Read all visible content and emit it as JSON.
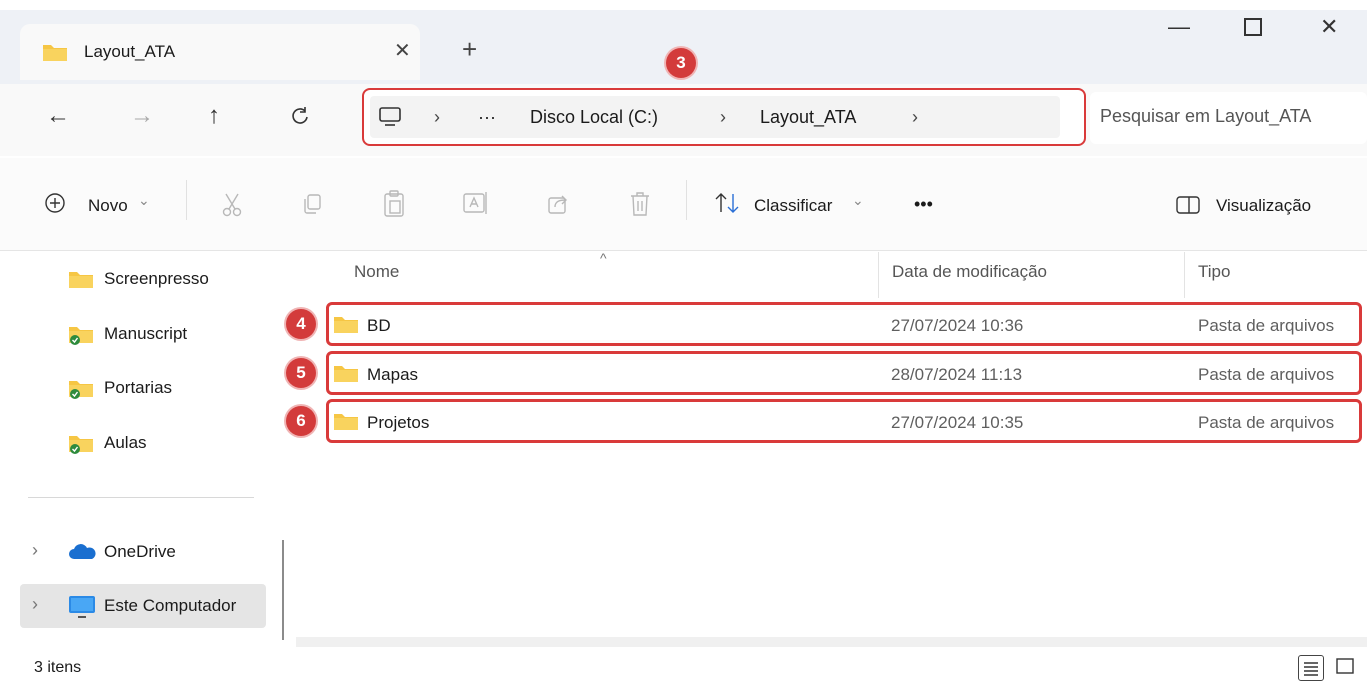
{
  "tab": {
    "title": "Layout_ATA",
    "close_glyph": "✕",
    "new_glyph": "+"
  },
  "window_controls": {
    "minimize": "—",
    "close": "✕"
  },
  "nav": {
    "back": "←",
    "forward": "→",
    "up": "↑",
    "refresh": "C"
  },
  "breadcrumb": {
    "overflow": "···",
    "sep": "›",
    "items": [
      "Disco Local (C:)",
      "Layout_ATA"
    ]
  },
  "search": {
    "placeholder": "Pesquisar em Layout_ATA"
  },
  "callouts": [
    "3",
    "4",
    "5",
    "6"
  ],
  "commandbar": {
    "new_label": "Novo",
    "sort_label": "Classificar",
    "more": "•••",
    "view_label": "Visualização",
    "dropdown": "⌄"
  },
  "sidebar": {
    "quick": [
      {
        "label": "Screenpresso"
      },
      {
        "label": "Manuscript"
      },
      {
        "label": "Portarias"
      },
      {
        "label": "Aulas"
      }
    ],
    "onedrive": "OneDrive",
    "thispc": "Este Computador",
    "chevron": "›"
  },
  "columns": {
    "name": "Nome",
    "date": "Data de modificação",
    "type": "Tipo"
  },
  "files": [
    {
      "name": "BD",
      "date": "27/07/2024 10:36",
      "type": "Pasta de arquivos"
    },
    {
      "name": "Mapas",
      "date": "28/07/2024 11:13",
      "type": "Pasta de arquivos"
    },
    {
      "name": "Projetos",
      "date": "27/07/2024 10:35",
      "type": "Pasta de arquivos"
    }
  ],
  "status": {
    "count": "3 itens"
  },
  "colors": {
    "accent_red": "#d93a3a",
    "folder": "#f6c644",
    "sync_green": "#2e8b3e"
  }
}
